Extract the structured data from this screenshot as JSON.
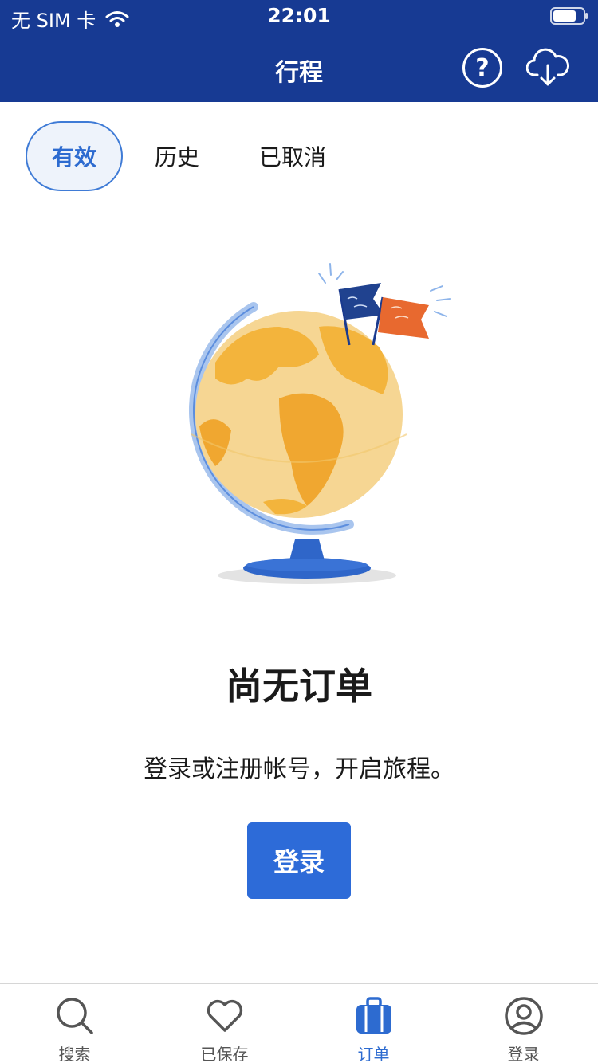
{
  "status_bar": {
    "carrier": "无 SIM 卡",
    "time": "22:01"
  },
  "nav": {
    "title": "行程",
    "help_icon": "help-circle-icon",
    "download_icon": "cloud-download-icon"
  },
  "tabs": [
    {
      "label": "有效",
      "active": true
    },
    {
      "label": "历史",
      "active": false
    },
    {
      "label": "已取消",
      "active": false
    }
  ],
  "empty_state": {
    "title": "尚无订单",
    "description": "登录或注册帐号，开启旅程。",
    "button_label": "登录",
    "illustration": "globe-with-flags"
  },
  "tab_bar": [
    {
      "label": "搜索",
      "icon": "search-icon",
      "active": false
    },
    {
      "label": "已保存",
      "icon": "heart-icon",
      "active": false
    },
    {
      "label": "订单",
      "icon": "suitcase-icon",
      "active": true
    },
    {
      "label": "登录",
      "icon": "user-circle-icon",
      "active": false
    }
  ],
  "colors": {
    "header": "#173a93",
    "accent": "#2d6bd8",
    "globe": "#f5b942"
  }
}
